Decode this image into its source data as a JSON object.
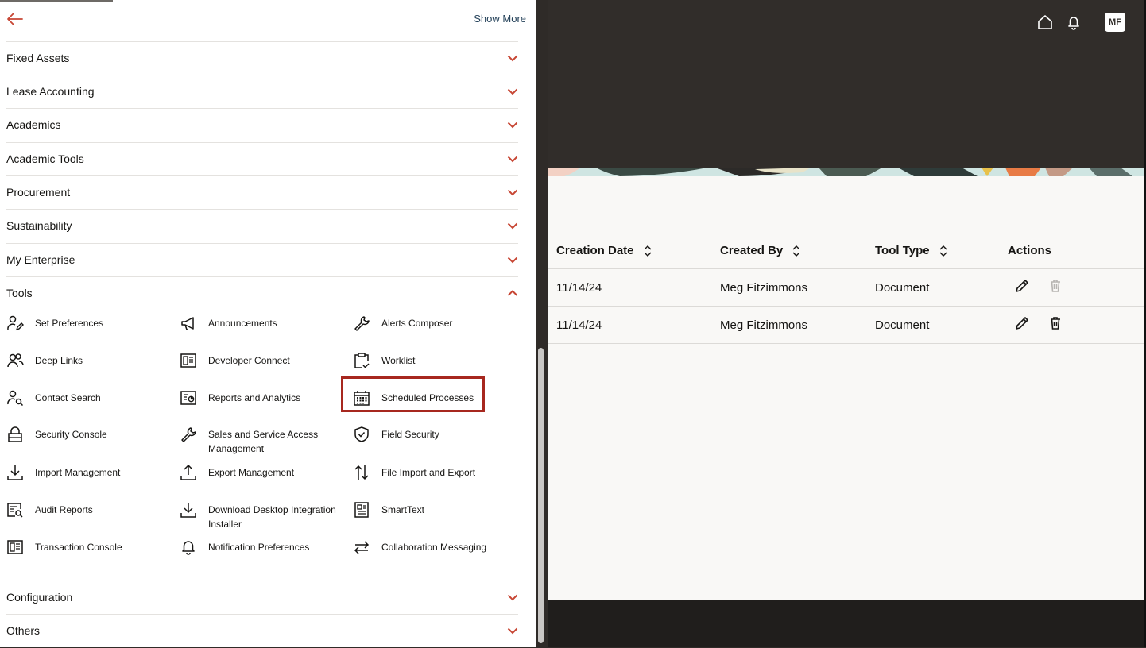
{
  "nav": {
    "show_more": "Show More",
    "sections": [
      {
        "label": "Fixed Assets",
        "expanded": false
      },
      {
        "label": "Lease Accounting",
        "expanded": false
      },
      {
        "label": "Academics",
        "expanded": false
      },
      {
        "label": "Academic Tools",
        "expanded": false
      },
      {
        "label": "Procurement",
        "expanded": false
      },
      {
        "label": "Sustainability",
        "expanded": false
      },
      {
        "label": "My Enterprise",
        "expanded": false
      },
      {
        "label": "Tools",
        "expanded": true
      },
      {
        "label": "Configuration",
        "expanded": false
      },
      {
        "label": "Others",
        "expanded": false
      }
    ],
    "tools": [
      {
        "label": "Set Preferences",
        "icon": "user-preferences-icon"
      },
      {
        "label": "Announcements",
        "icon": "megaphone-icon"
      },
      {
        "label": "Alerts Composer",
        "icon": "wrench-icon"
      },
      {
        "label": "Deep Links",
        "icon": "users-icon"
      },
      {
        "label": "Developer Connect",
        "icon": "developer-panel-icon"
      },
      {
        "label": "Worklist",
        "icon": "clipboard-check-icon"
      },
      {
        "label": "Contact Search",
        "icon": "user-search-icon"
      },
      {
        "label": "Reports and Analytics",
        "icon": "report-chart-icon"
      },
      {
        "label": "Scheduled Processes",
        "icon": "calendar-grid-icon"
      },
      {
        "label": "Security Console",
        "icon": "lock-icon"
      },
      {
        "label": "Sales and Service Access Management",
        "icon": "wrench-icon"
      },
      {
        "label": "Field Security",
        "icon": "shield-check-icon"
      },
      {
        "label": "Import Management",
        "icon": "download-icon"
      },
      {
        "label": "Export Management",
        "icon": "upload-icon"
      },
      {
        "label": "File Import and Export",
        "icon": "up-down-arrows-icon"
      },
      {
        "label": "Audit Reports",
        "icon": "audit-report-icon"
      },
      {
        "label": "Download Desktop Integration Installer",
        "icon": "download-icon"
      },
      {
        "label": "SmartText",
        "icon": "smarttext-icon"
      },
      {
        "label": "Transaction Console",
        "icon": "console-panel-icon"
      },
      {
        "label": "Notification Preferences",
        "icon": "bell-icon"
      },
      {
        "label": "Collaboration Messaging",
        "icon": "swap-arrows-icon"
      }
    ]
  },
  "header": {
    "avatar_initials": "MF"
  },
  "table": {
    "columns": [
      "Creation Date",
      "Created By",
      "Tool Type",
      "Actions"
    ],
    "rows": [
      {
        "creation_date": "11/14/24",
        "created_by": "Meg Fitzimmons",
        "tool_type": "Document",
        "delete_enabled": false
      },
      {
        "creation_date": "11/14/24",
        "created_by": "Meg Fitzimmons",
        "tool_type": "Document",
        "delete_enabled": true
      }
    ]
  },
  "colors": {
    "accent": "#c74634",
    "highlight_border": "#a7281f",
    "header_bg": "#312d2a"
  }
}
